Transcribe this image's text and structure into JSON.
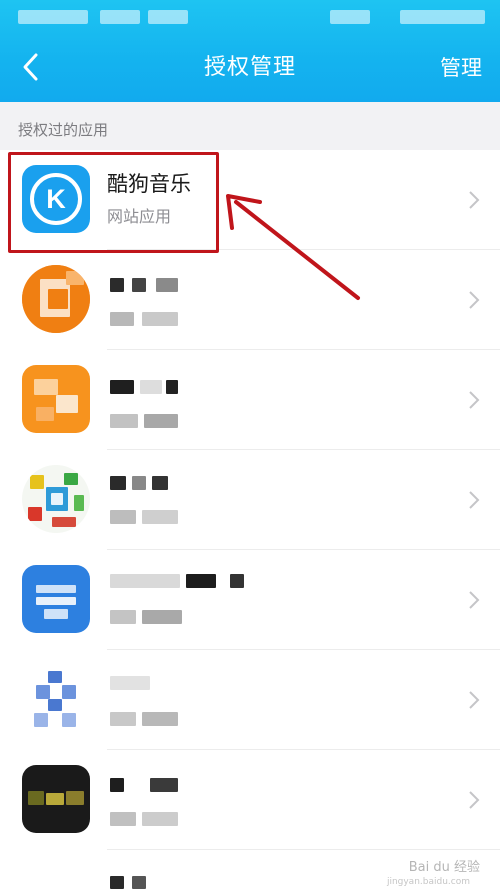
{
  "header": {
    "title": "授权管理",
    "action_label": "管理",
    "background_color": "#14b3ef"
  },
  "section": {
    "label": "授权过的应用"
  },
  "apps": [
    {
      "name": "酷狗音乐",
      "subtitle": "网站应用",
      "icon": "kugou-music-icon",
      "icon_color": "#1aa0ee",
      "highlighted": true
    },
    {
      "name": "",
      "subtitle": "",
      "icon": "blurred-app-icon",
      "icon_color": "#f07f12",
      "redacted": true
    },
    {
      "name": "",
      "subtitle": "",
      "icon": "blurred-app-icon",
      "icon_color": "#f7931e",
      "redacted": true
    },
    {
      "name": "",
      "subtitle": "",
      "icon": "blurred-app-icon",
      "icon_color": "#2e9bd8",
      "redacted": true
    },
    {
      "name": "",
      "subtitle": "",
      "icon": "blurred-app-icon",
      "icon_color": "#2d80e0",
      "redacted": true
    },
    {
      "name": "",
      "subtitle": "",
      "icon": "blurred-app-icon",
      "icon_color": "#4a78d0",
      "redacted": true
    },
    {
      "name": "",
      "subtitle": "",
      "icon": "blurred-app-icon",
      "icon_color": "#1a1a1a",
      "redacted": true
    }
  ],
  "annotation": {
    "color": "#c0151b"
  },
  "watermark": {
    "text": "Bai du 经验",
    "sub": "jingyan.baidu.com"
  }
}
